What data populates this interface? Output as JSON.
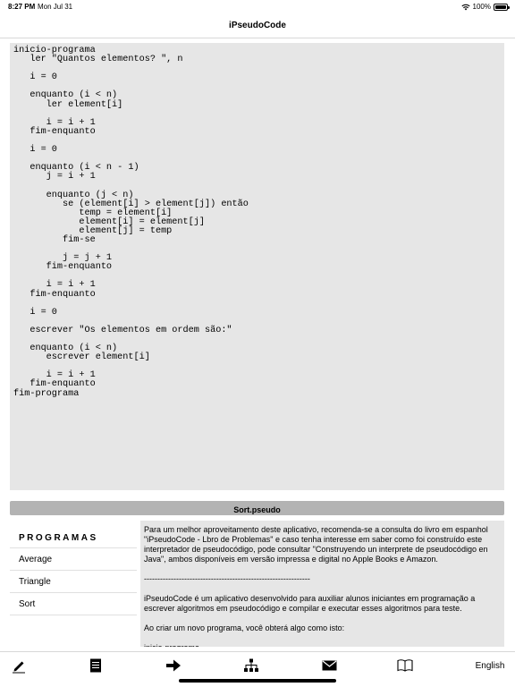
{
  "status_bar": {
    "time": "8:27 PM",
    "date": "Mon Jul 31",
    "battery": "100%"
  },
  "nav": {
    "title": "iPseudoCode"
  },
  "editor": {
    "code": "inicio-programa\n   ler \"Quantos elementos? \", n\n\n   i = 0\n\n   enquanto (i < n)\n      ler element[i]\n\n      i = i + 1\n   fim-enquanto\n\n   i = 0\n\n   enquanto (i < n - 1)\n      j = i + 1\n\n      enquanto (j < n)\n         se (element[i] > element[j]) então\n            temp = element[i]\n            element[i] = element[j]\n            element[j] = temp\n         fim-se\n\n         j = j + 1\n      fim-enquanto\n\n      i = i + 1\n   fim-enquanto\n\n   i = 0\n\n   escrever \"Os elementos em ordem são:\"\n\n   enquanto (i < n)\n      escrever element[i]\n\n      i = i + 1\n   fim-enquanto\nfim-programa"
  },
  "file": {
    "name": "Sort.pseudo"
  },
  "programs": {
    "header": "PROGRAMAS",
    "items": [
      "Average",
      "Triangle",
      "Sort"
    ]
  },
  "info": {
    "paragraph1": "Para um melhor aproveitamento deste aplicativo, recomenda-se a consulta do livro em espanhol \"iPseudoCode - Lbro de Problemas\" e caso tenha interesse em saber como foi construído este interpretador de pseudocódigo, pode consultar \"Construyendo un interprete de pseudocódigo en Java\", ambos disponíveis em versão impressa e digital no Apple Books e Amazon.",
    "separator": "--------------------------------------------------------------",
    "paragraph2": "iPseudoCode é um aplicativo desenvolvido para auxiliar alunos iniciantes em programação a escrever algoritmos em pseudocódigo e compilar e executar esses algoritmos para teste.",
    "paragraph3": "Ao criar um novo programa, você obterá algo como isto:",
    "paragraph4": "inicio-programa"
  },
  "tab_bar": {
    "icons": [
      "pencil-icon",
      "document-icon",
      "arrow-right-icon",
      "hierarchy-icon",
      "envelope-icon",
      "book-icon"
    ],
    "language": "English"
  },
  "colors": {
    "editor_background": "#e6e6e6",
    "file_bar": "#b3b3b3",
    "separator": "#d8d8d8"
  }
}
